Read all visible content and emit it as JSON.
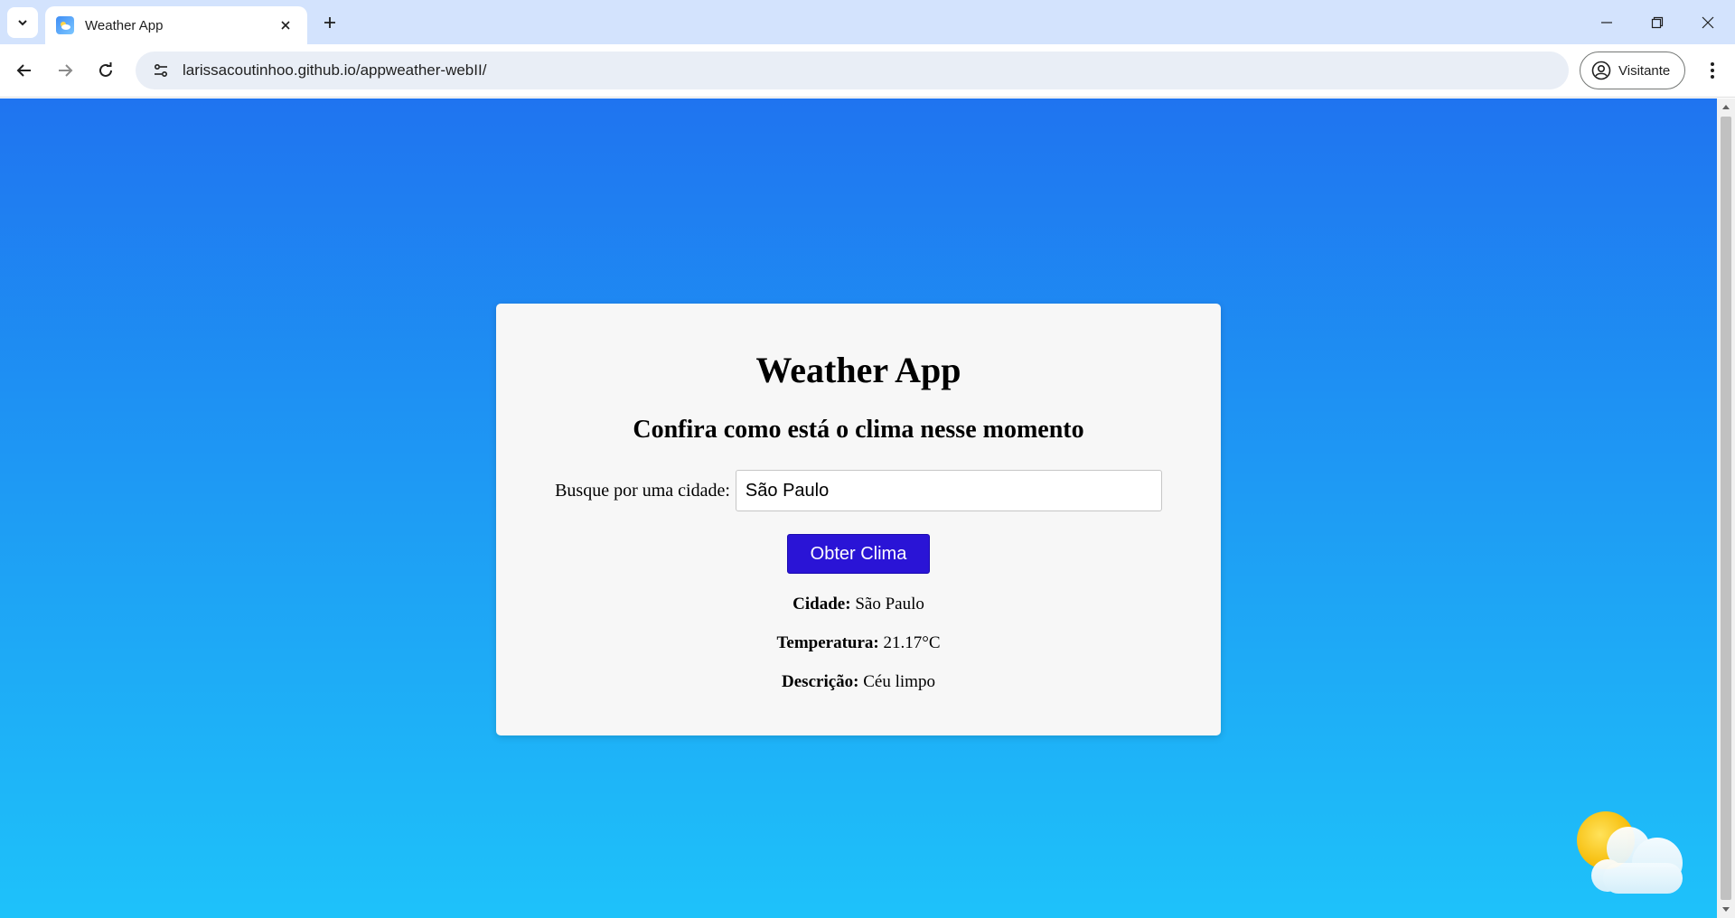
{
  "browser": {
    "tab_title": "Weather App",
    "url": "larissacoutinhoo.github.io/appweather-webII/",
    "profile_label": "Visitante",
    "icons": [
      "tab-search-icon",
      "weather-favicon-icon",
      "close-icon",
      "plus-icon",
      "minimize-icon",
      "restore-icon",
      "close-window-icon",
      "back-icon",
      "forward-icon",
      "reload-icon",
      "site-settings-icon",
      "profile-icon",
      "kebab-menu-icon"
    ]
  },
  "app": {
    "title": "Weather App",
    "subtitle": "Confira como está o clima nesse momento",
    "search": {
      "label": "Busque por uma cidade:",
      "value": "São Paulo"
    },
    "button_label": "Obter Clima",
    "results": {
      "city_label": "Cidade:",
      "city_value": "São Paulo",
      "temp_label": "Temperatura:",
      "temp_value": "21.17°C",
      "desc_label": "Descrição:",
      "desc_value": "Céu limpo"
    },
    "colors": {
      "background_top": "#1f74f0",
      "background_bottom": "#1ec2fa",
      "button": "#2a14d6",
      "card": "#f7f7f7"
    },
    "decoration_icon": "sun-cloud-icon"
  }
}
